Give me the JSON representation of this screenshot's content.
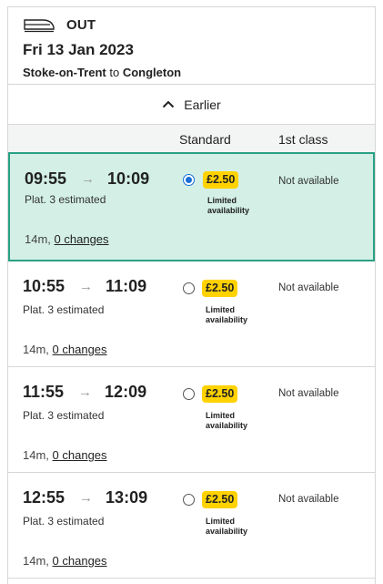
{
  "header": {
    "direction": "OUT",
    "date": "Fri 13 Jan 2023",
    "origin": "Stoke-on-Trent",
    "connector": "to",
    "destination": "Congleton",
    "icon": "train-icon"
  },
  "earlier": {
    "label": "Earlier",
    "icon": "chevron-up-icon"
  },
  "columns": {
    "standard": "Standard",
    "first": "1st class"
  },
  "journeys": [
    {
      "depart": "09:55",
      "arrive": "10:09",
      "platform": "Plat. 3 estimated",
      "duration": "14m,",
      "changes": "0 changes",
      "price": "£2.50",
      "availability": "Limited availability",
      "first_class": "Not available",
      "selected": true
    },
    {
      "depart": "10:55",
      "arrive": "11:09",
      "platform": "Plat. 3 estimated",
      "duration": "14m,",
      "changes": "0 changes",
      "price": "£2.50",
      "availability": "Limited availability",
      "first_class": "Not available",
      "selected": false
    },
    {
      "depart": "11:55",
      "arrive": "12:09",
      "platform": "Plat. 3 estimated",
      "duration": "14m,",
      "changes": "0 changes",
      "price": "£2.50",
      "availability": "Limited availability",
      "first_class": "Not available",
      "selected": false
    },
    {
      "depart": "12:55",
      "arrive": "13:09",
      "platform": "Plat. 3 estimated",
      "duration": "14m,",
      "changes": "0 changes",
      "price": "£2.50",
      "availability": "Limited availability",
      "first_class": "Not available",
      "selected": false
    }
  ],
  "colors": {
    "selected_bg": "#d3efe6",
    "selected_border": "#2aa185",
    "price_badge": "#ffd200",
    "radio_selected": "#1a6fd8"
  }
}
